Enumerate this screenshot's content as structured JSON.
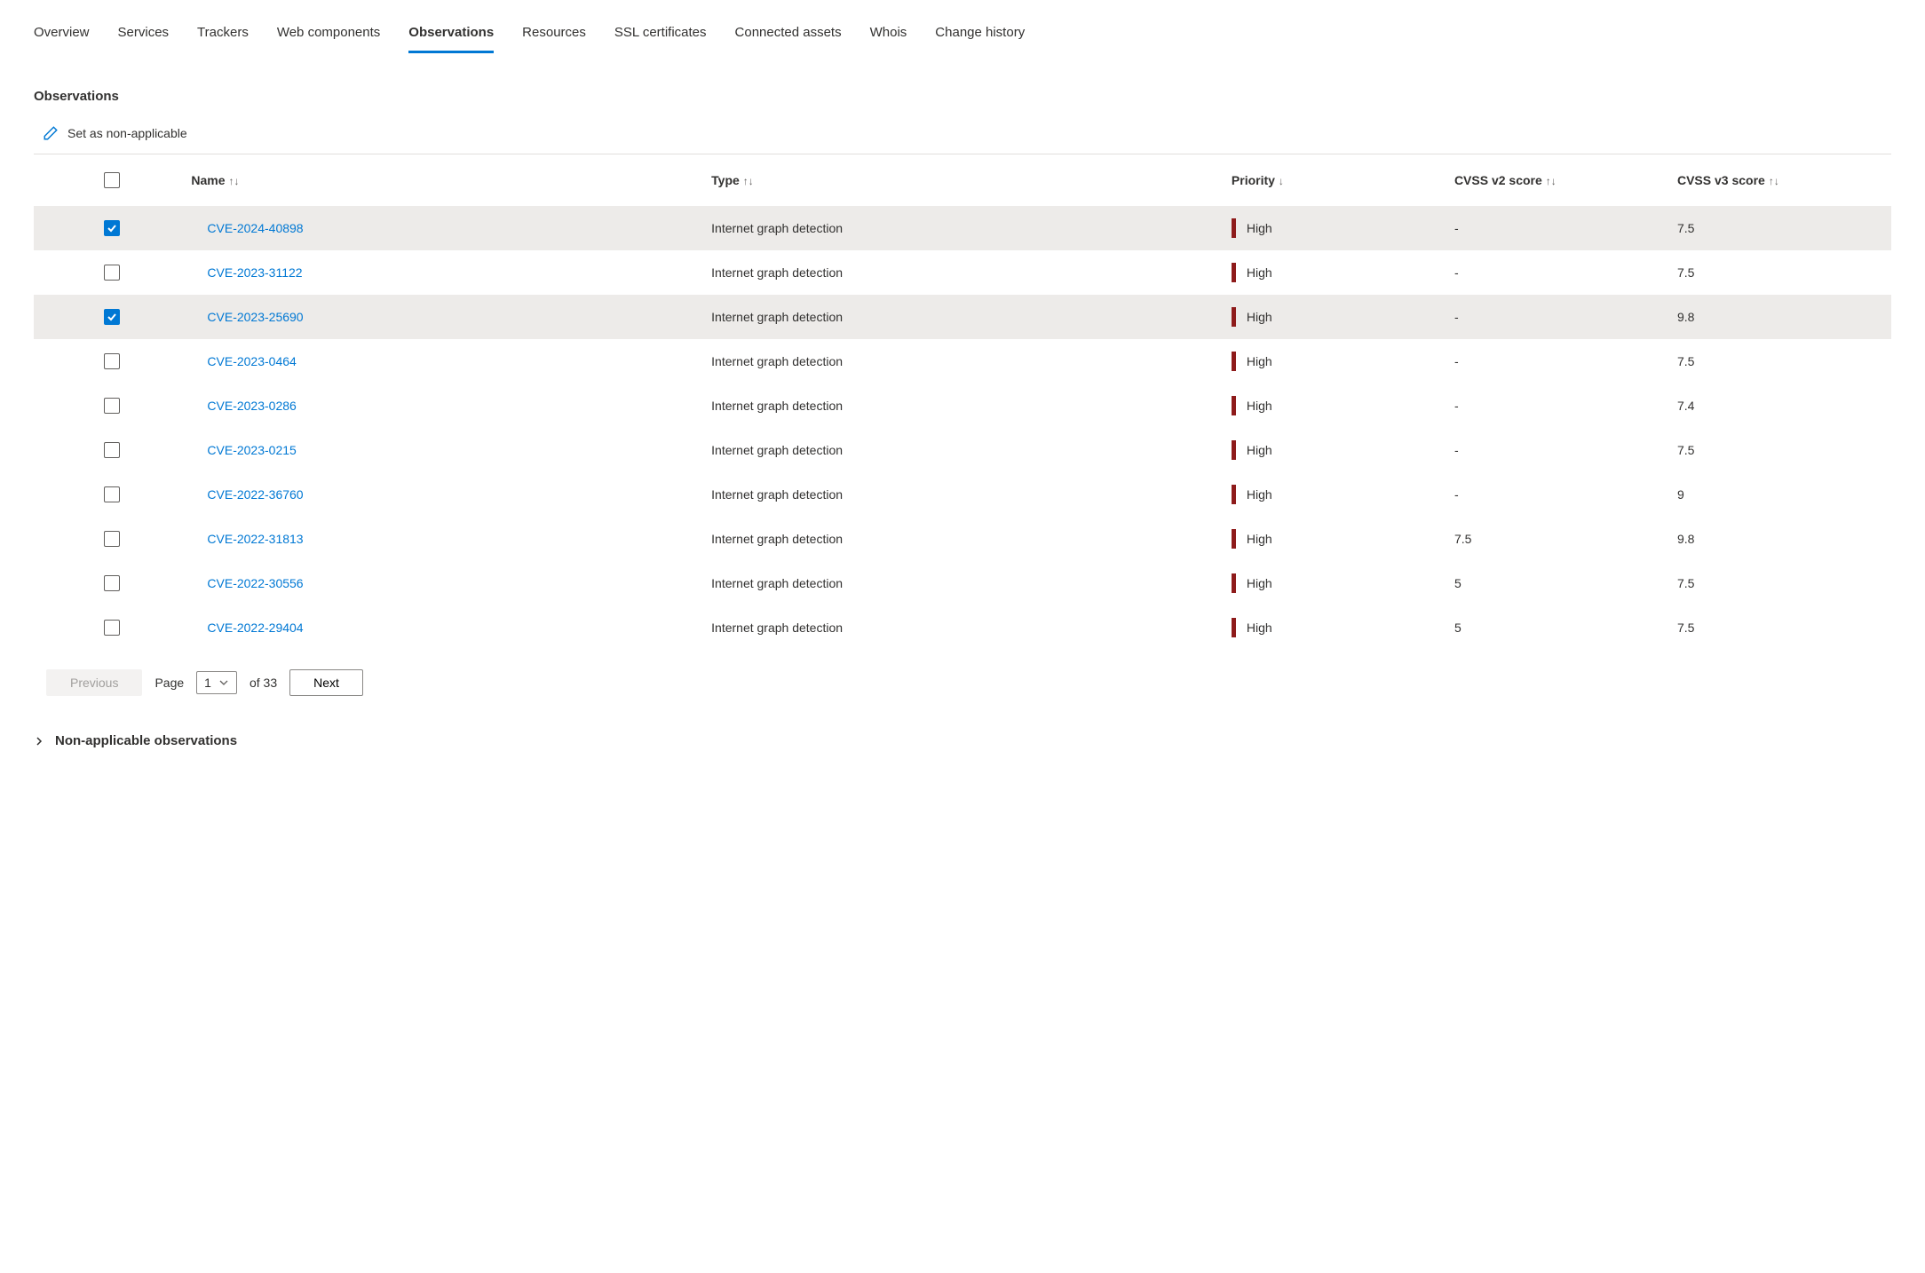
{
  "tabs": [
    {
      "label": "Overview",
      "active": false
    },
    {
      "label": "Services",
      "active": false
    },
    {
      "label": "Trackers",
      "active": false
    },
    {
      "label": "Web components",
      "active": false
    },
    {
      "label": "Observations",
      "active": true
    },
    {
      "label": "Resources",
      "active": false
    },
    {
      "label": "SSL certificates",
      "active": false
    },
    {
      "label": "Connected assets",
      "active": false
    },
    {
      "label": "Whois",
      "active": false
    },
    {
      "label": "Change history",
      "active": false
    }
  ],
  "section_title": "Observations",
  "action": {
    "label": "Set as non-applicable"
  },
  "columns": {
    "name": "Name",
    "type": "Type",
    "priority": "Priority",
    "cvss_v2": "CVSS v2 score",
    "cvss_v3": "CVSS v3 score"
  },
  "sort_icons": {
    "both": "↑↓",
    "down": "↓"
  },
  "rows": [
    {
      "checked": true,
      "name": "CVE-2024-40898",
      "type": "Internet graph detection",
      "priority": "High",
      "v2": "-",
      "v3": "7.5"
    },
    {
      "checked": false,
      "name": "CVE-2023-31122",
      "type": "Internet graph detection",
      "priority": "High",
      "v2": "-",
      "v3": "7.5"
    },
    {
      "checked": true,
      "name": "CVE-2023-25690",
      "type": "Internet graph detection",
      "priority": "High",
      "v2": "-",
      "v3": "9.8"
    },
    {
      "checked": false,
      "name": "CVE-2023-0464",
      "type": "Internet graph detection",
      "priority": "High",
      "v2": "-",
      "v3": "7.5"
    },
    {
      "checked": false,
      "name": "CVE-2023-0286",
      "type": "Internet graph detection",
      "priority": "High",
      "v2": "-",
      "v3": "7.4"
    },
    {
      "checked": false,
      "name": "CVE-2023-0215",
      "type": "Internet graph detection",
      "priority": "High",
      "v2": "-",
      "v3": "7.5"
    },
    {
      "checked": false,
      "name": "CVE-2022-36760",
      "type": "Internet graph detection",
      "priority": "High",
      "v2": "-",
      "v3": "9"
    },
    {
      "checked": false,
      "name": "CVE-2022-31813",
      "type": "Internet graph detection",
      "priority": "High",
      "v2": "7.5",
      "v3": "9.8"
    },
    {
      "checked": false,
      "name": "CVE-2022-30556",
      "type": "Internet graph detection",
      "priority": "High",
      "v2": "5",
      "v3": "7.5"
    },
    {
      "checked": false,
      "name": "CVE-2022-29404",
      "type": "Internet graph detection",
      "priority": "High",
      "v2": "5",
      "v3": "7.5"
    }
  ],
  "pager": {
    "previous": "Previous",
    "next": "Next",
    "page_label": "Page",
    "current_page": "1",
    "of_label": "of 33"
  },
  "collapsible": {
    "label": "Non-applicable observations"
  }
}
